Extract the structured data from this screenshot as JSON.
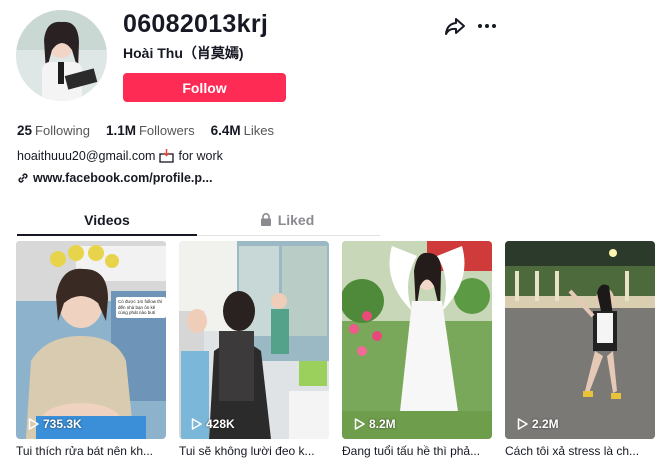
{
  "profile": {
    "username": "06082013krj",
    "nickname": "Hoài Thu（肖莫嫣)",
    "follow_label": "Follow",
    "avatar_icon": "avatar-photo"
  },
  "stats": {
    "following_count": "25",
    "following_label": "Following",
    "followers_count": "1.1M",
    "followers_label": "Followers",
    "likes_count": "6.4M",
    "likes_label": "Likes"
  },
  "bio": {
    "email": "hoaithuuu20@gmail.com",
    "suffix": "for work",
    "icon": "inbox-icon"
  },
  "link": {
    "text": "www.facebook.com/profile.p...",
    "icon": "link-icon"
  },
  "tabs": {
    "videos": "Videos",
    "liked": "Liked"
  },
  "videos": [
    {
      "views": "735.3K",
      "caption": "Tui thích rửa bát nên kh...",
      "overlay": "Có được 1m follow thì đến nhà bạn ôn kê cùng phát nào buti"
    },
    {
      "views": "428K",
      "caption": "Tui sẽ không lười đeo k..."
    },
    {
      "views": "8.2M",
      "caption": "Đang tuổi tấu hề thì phả..."
    },
    {
      "views": "2.2M",
      "caption": "Cách tôi xả stress là ch..."
    }
  ],
  "colors": {
    "accent": "#fe2c55",
    "text": "#161823",
    "muted": "#8a8b91"
  }
}
